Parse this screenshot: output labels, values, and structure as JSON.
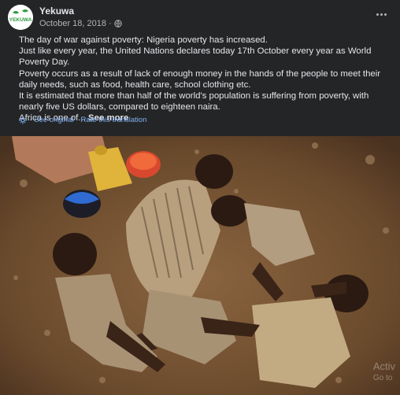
{
  "post": {
    "author": "Yekuwa",
    "logo_text": "YEKUWA",
    "date": "October 18, 2018",
    "audience_icon": "globe-icon",
    "paragraphs": [
      "The day of war against poverty: Nigeria poverty has increased.",
      "Just like every year, the United Nations declares today 17th October every year as World Poverty Day.",
      "Poverty occurs as a result of lack of enough money in the hands of the people to meet their daily needs, such as food, health care, school clothing etc.",
      "It is estimated that more than half of the world's population is suffering from poverty, with nearly five US dollars, compared to eighteen naira."
    ],
    "truncated_line": "Africa is one of...",
    "see_more": "See more",
    "see_original": "See original",
    "separator": "·",
    "rate_translation": "Rate this translation"
  },
  "watermark": {
    "line1": "Activ",
    "line2": "Go to"
  },
  "colors": {
    "background": "#242526",
    "text": "#e4e6eb",
    "secondary_text": "#b0b3b8",
    "link": "#7fb0f5",
    "logo_green": "#2e9a3e"
  }
}
